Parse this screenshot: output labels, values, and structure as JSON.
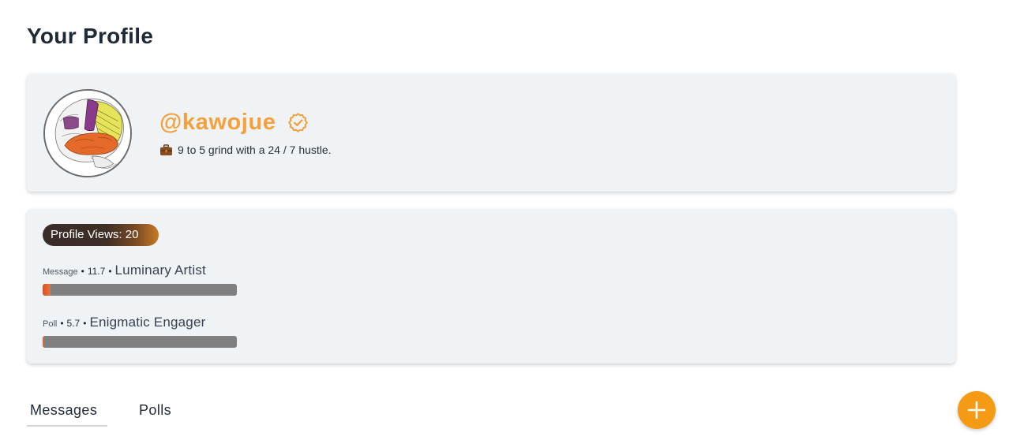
{
  "page": {
    "title": "Your Profile"
  },
  "profile": {
    "handle": "@kawojue",
    "verified": true,
    "bio_icon": "briefcase-icon",
    "bio": "9 to 5 grind with a 24 / 7 hustle.",
    "avatar": "brain-illustration"
  },
  "stats": {
    "views_label": "Profile Views: 20",
    "items": [
      {
        "type": "Message",
        "score": "11.7",
        "rank": "Luminary Artist",
        "progress_fraction": 0.04
      },
      {
        "type": "Poll",
        "score": "5.7",
        "rank": "Enigmatic Engager",
        "progress_fraction": 0.01
      }
    ]
  },
  "tabs": [
    {
      "label": "Messages",
      "active": true
    },
    {
      "label": "Polls",
      "active": false
    }
  ],
  "fab": {
    "icon": "plus-icon",
    "color": "#f59a14"
  },
  "colors": {
    "accent": "#f5a03a",
    "card_bg": "#f0f3f6",
    "bar_track": "#808080",
    "bar_fill": "#e0642f"
  }
}
